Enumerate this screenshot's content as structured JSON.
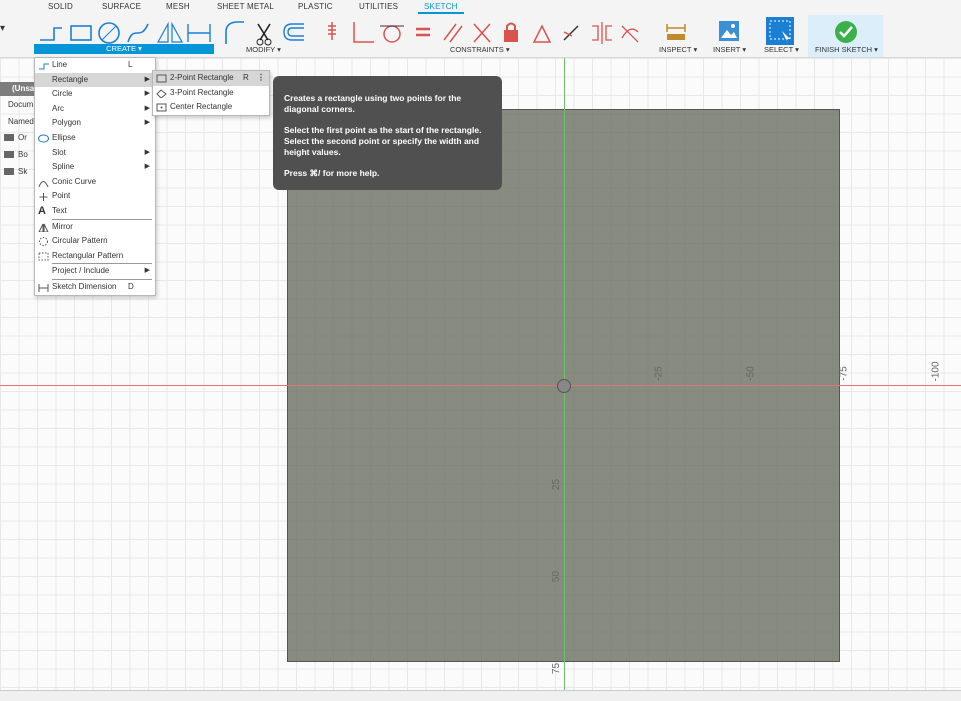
{
  "tabs": [
    "SOLID",
    "SURFACE",
    "MESH",
    "SHEET METAL",
    "PLASTIC",
    "UTILITIES",
    "SKETCH"
  ],
  "active_tab": "SKETCH",
  "toolbar": {
    "create_label": "CREATE ▾",
    "modify_label": "MODIFY ▾",
    "constraints_label": "CONSTRAINTS ▾",
    "inspect_label": "INSPECT ▾",
    "insert_label": "INSERT ▾",
    "select_label": "SELECT ▾",
    "finish_sketch_label": "FINISH SKETCH ▾"
  },
  "browser": {
    "title": "(Unsa",
    "document_settings": "Docum",
    "named_views": "Named",
    "items": [
      "Or",
      "Bo",
      "Sk"
    ]
  },
  "create_menu": {
    "items": [
      {
        "label": "Line",
        "shortcut": "L",
        "icon": "line-icon"
      },
      {
        "label": "Rectangle",
        "arrow": "▶",
        "icon": "rectangle-icon",
        "highlighted": true
      },
      {
        "label": "Circle",
        "arrow": "▶",
        "icon": "circle-icon"
      },
      {
        "label": "Arc",
        "arrow": "▶",
        "icon": "arc-icon"
      },
      {
        "label": "Polygon",
        "arrow": "▶",
        "icon": "polygon-icon"
      },
      {
        "label": "Ellipse",
        "icon": "ellipse-icon"
      },
      {
        "label": "Slot",
        "arrow": "▶",
        "icon": "slot-icon"
      },
      {
        "label": "Spline",
        "arrow": "▶",
        "icon": "spline-icon"
      },
      {
        "label": "Conic Curve",
        "icon": "conic-curve-icon"
      },
      {
        "label": "Point",
        "icon": "point-icon"
      },
      {
        "label": "Text",
        "icon": "text-icon"
      },
      {
        "label": "Mirror",
        "icon": "mirror-icon"
      },
      {
        "label": "Circular Pattern",
        "icon": "circular-pattern-icon"
      },
      {
        "label": "Rectangular Pattern",
        "icon": "rectangular-pattern-icon"
      },
      {
        "label": "Project / Include",
        "arrow": "▶",
        "icon": "project-include-icon"
      },
      {
        "label": "Sketch Dimension",
        "shortcut": "D",
        "icon": "sketch-dimension-icon"
      }
    ]
  },
  "rectangle_submenu": {
    "items": [
      {
        "label": "2-Point Rectangle",
        "shortcut": "R",
        "icon": "two-point-rectangle-icon",
        "highlighted": true
      },
      {
        "label": "3-Point Rectangle",
        "icon": "three-point-rectangle-icon"
      },
      {
        "label": "Center Rectangle",
        "icon": "center-rectangle-icon"
      }
    ],
    "more_glyph": "⋮"
  },
  "tooltip": {
    "line1": "Creates a rectangle using two points for the diagonal corners.",
    "line2": "Select the first point as the start of the rectangle. Select the second point or specify the width and height values.",
    "line3": "Press ⌘/ for more help."
  },
  "rulers": {
    "horizontal": [
      "-25",
      "-50",
      "-75",
      "-100"
    ],
    "vertical": [
      "25",
      "50",
      "75"
    ]
  },
  "colors": {
    "accent": "#0696d7",
    "sketch_fill": "#6e7264",
    "axis_x": "#e57373",
    "axis_y": "#6cc36c",
    "tooltip_bg": "#505050"
  }
}
